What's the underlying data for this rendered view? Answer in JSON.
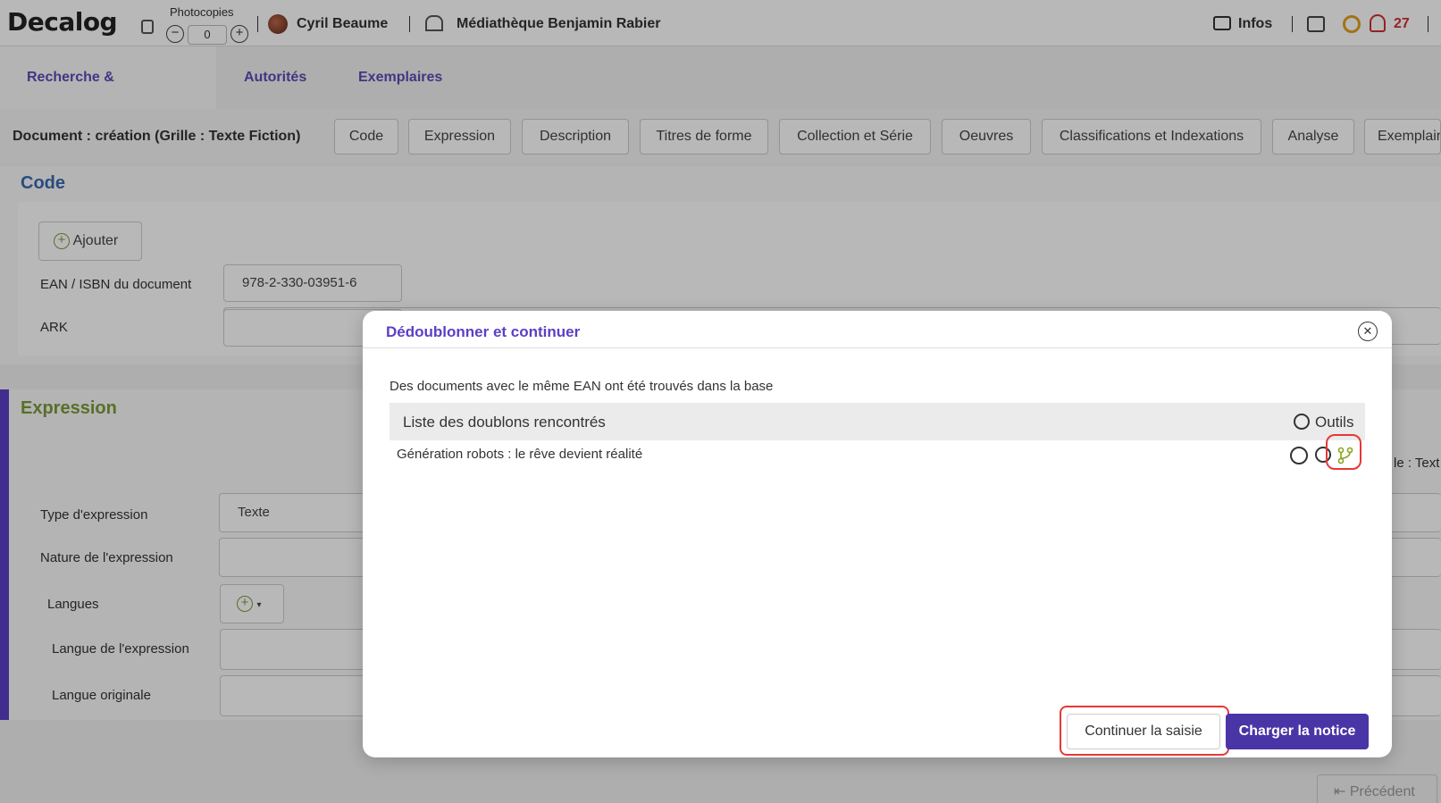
{
  "header": {
    "logo": "Decalog",
    "photocopies_label": "Photocopies",
    "photocopies_value": "0",
    "user_name": "Cyril Beaume",
    "library_name": "Médiathèque Benjamin Rabier",
    "infos_label": "Infos",
    "notifications_count": "27"
  },
  "nav": {
    "tabs": [
      {
        "label": "Recherche & catalogage"
      },
      {
        "label": "Autorités"
      },
      {
        "label": "Exemplaires"
      }
    ]
  },
  "document": {
    "title": "Document : création (Grille : Texte Fiction)",
    "subtabs": [
      {
        "label": "Code"
      },
      {
        "label": "Expression"
      },
      {
        "label": "Description"
      },
      {
        "label": "Titres de forme"
      },
      {
        "label": "Collection et Série"
      },
      {
        "label": "Oeuvres"
      },
      {
        "label": "Classifications et Indexations"
      },
      {
        "label": "Analyse"
      },
      {
        "label": "Exemplair"
      }
    ]
  },
  "form": {
    "code_section_title": "Code",
    "add_button": "Ajouter",
    "ean_label": "EAN / ISBN du document",
    "ean_value": "978-2-330-03951-6",
    "ark_label": "ARK",
    "expression_section_title": "Expression",
    "right_partial_text": "le : Text",
    "type_label": "Type d'expression",
    "type_value": "Texte",
    "nature_label": "Nature de l'expression",
    "langues_label": "Langues",
    "langue_expr_label": "Langue de l'expression",
    "langue_orig_label": "Langue originale",
    "prev_button": "Précédent"
  },
  "modal": {
    "title": "Dédoublonner et continuer",
    "message": "Des documents avec le même EAN ont été trouvés dans la base",
    "list_header": "Liste des doublons rencontrés",
    "tools_label": "Outils",
    "rows": [
      {
        "label": "Génération robots : le rêve devient réalité"
      }
    ],
    "continue_button": "Continuer la saisie",
    "load_button": "Charger la notice"
  },
  "colors": {
    "accent": "#5b3fc4",
    "primary_button": "#4a35a6",
    "highlight": "#e53935",
    "notification": "#d32f2f"
  }
}
